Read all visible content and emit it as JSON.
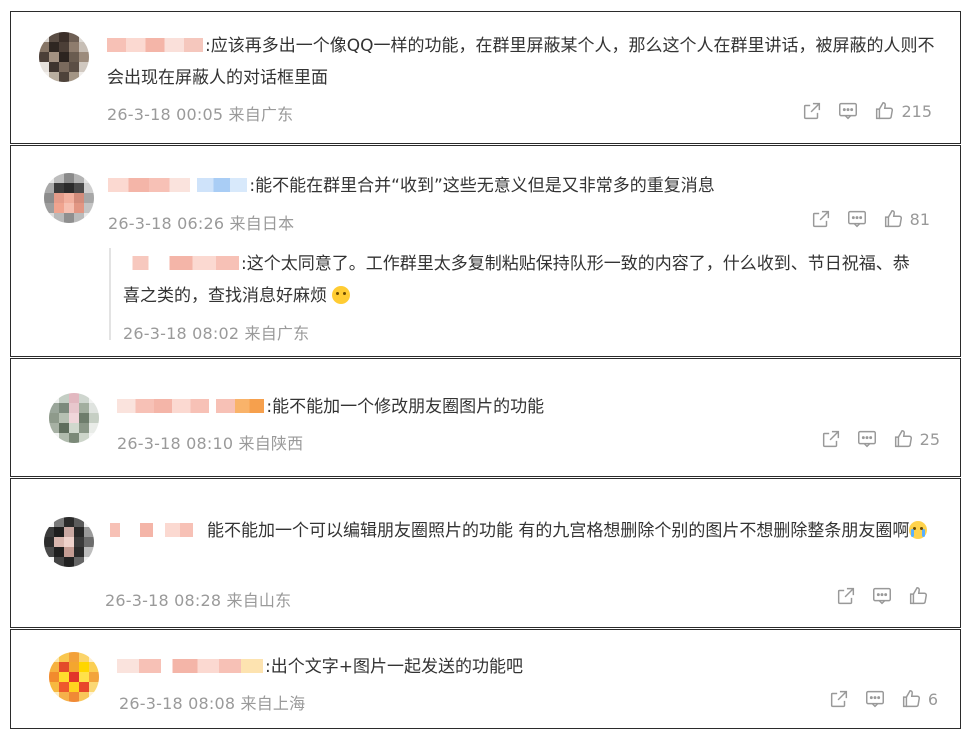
{
  "comments": [
    {
      "text": ":应该再多出一个像QQ一样的功能，在群里屏蔽某个人，那么这个人在群里讲话，被屏蔽的人则不会出现在屏蔽人的对话框里面",
      "meta": "26-3-18 00:05 来自广东",
      "likes": "215"
    },
    {
      "text": ":能不能在群里合并“收到”这些无意义但是又非常多的重复消息",
      "meta": "26-3-18 06:26 来自日本",
      "likes": "81",
      "reply": {
        "text": ":这个太同意了。工作群里太多复制粘贴保持队形一致的内容了，什么收到、节日祝福、恭喜之类的，查找消息好麻烦",
        "meta": "26-3-18 08:02 来自广东"
      }
    },
    {
      "text": ":能不能加一个修改朋友圈图片的功能",
      "meta": "26-3-18 08:10 来自陕西",
      "likes": "25"
    },
    {
      "text": "能不能加一个可以编辑朋友圈照片的功能  有的九宫格想删除个别的图片不想删除整条朋友圈啊",
      "meta": "26-3-18  08:28 来自山东",
      "likes": ""
    },
    {
      "text": ":出个文字+图片一起发送的功能吧",
      "meta": "26-3-18 08:08 来自上海",
      "likes": "6"
    }
  ],
  "icons": {
    "share": "share-icon",
    "comment": "comment-icon",
    "like": "thumbs-up-icon",
    "emoji": "smile-emoji-icon",
    "cry": "crying-emoji-icon"
  },
  "colors": {
    "text": "#333333",
    "meta": "#9a9a9a",
    "border": "#2b2b2b",
    "icon": "#999999"
  }
}
